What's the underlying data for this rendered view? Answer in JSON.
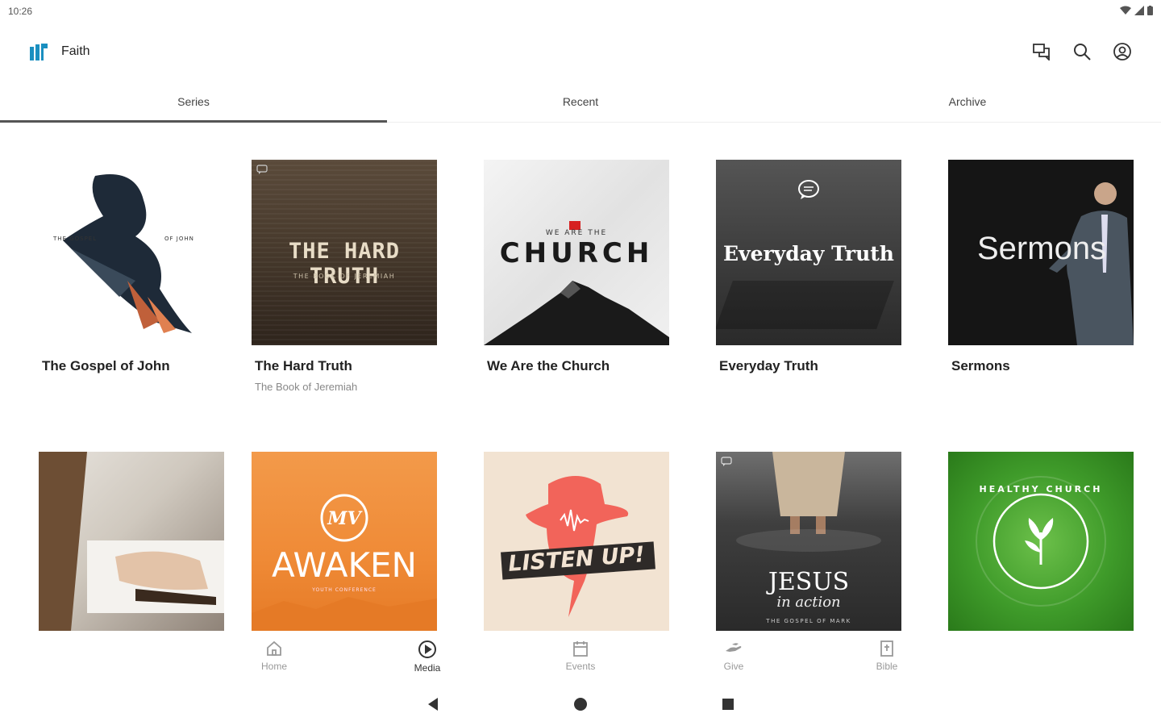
{
  "status": {
    "time": "10:26"
  },
  "app": {
    "title": "Faith",
    "logo_icon": "app-logo-icon"
  },
  "header_actions": [
    "chat-icon",
    "search-icon",
    "account-icon"
  ],
  "tabs": [
    {
      "label": "Series",
      "active": true
    },
    {
      "label": "Recent",
      "active": false
    },
    {
      "label": "Archive",
      "active": false
    }
  ],
  "series": [
    {
      "title": "The Gospel of John",
      "subtitle": "",
      "art": {
        "left_text": "THE GOSPEL",
        "right_text": "OF JOHN"
      }
    },
    {
      "title": "The Hard Truth",
      "subtitle": "The Book of Jeremiah",
      "art": {
        "headline": "THE HARD TRUTH",
        "tagline": "THE BOOK OF JEREMIAH"
      }
    },
    {
      "title": "We Are the Church",
      "subtitle": "",
      "art": {
        "headline": "CHURCH",
        "kicker": "WE ARE THE"
      }
    },
    {
      "title": "Everyday Truth",
      "subtitle": "",
      "art": {
        "headline": "Everyday Truth"
      }
    },
    {
      "title": "Sermons",
      "subtitle": "",
      "art": {
        "headline": "Sermons"
      }
    },
    {
      "title": "",
      "subtitle": "",
      "art": {}
    },
    {
      "title": "",
      "subtitle": "",
      "art": {
        "headline": "AWAKEN",
        "mark": "MV",
        "tagline": "YOUTH CONFERENCE"
      }
    },
    {
      "title": "",
      "subtitle": "",
      "art": {
        "headline": "LISTEN UP!"
      }
    },
    {
      "title": "",
      "subtitle": "",
      "art": {
        "headline": "JESUS",
        "script": "in action",
        "tagline": "THE GOSPEL OF MARK"
      }
    },
    {
      "title": "",
      "subtitle": "",
      "art": {
        "headline": "HEALTHY CHURCH"
      }
    }
  ],
  "bottom_nav": [
    {
      "label": "Home",
      "icon": "home-icon"
    },
    {
      "label": "Media",
      "icon": "play-circle-icon",
      "active": true
    },
    {
      "label": "Events",
      "icon": "calendar-icon"
    },
    {
      "label": "Give",
      "icon": "give-hand-icon"
    },
    {
      "label": "Bible",
      "icon": "bible-icon"
    }
  ],
  "colors": {
    "accent_logo": "#1a8fc0",
    "awaken_orange": "#f08a3a",
    "listen_red": "#f2645a",
    "healthy_green": "#3a9a2a"
  }
}
